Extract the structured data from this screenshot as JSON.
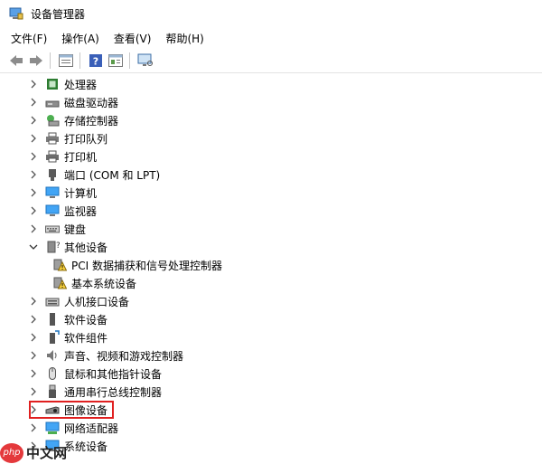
{
  "window": {
    "title": "设备管理器"
  },
  "menu": [
    {
      "label": "文件(F)",
      "name": "menu-file"
    },
    {
      "label": "操作(A)",
      "name": "menu-action"
    },
    {
      "label": "查看(V)",
      "name": "menu-view"
    },
    {
      "label": "帮助(H)",
      "name": "menu-help"
    }
  ],
  "toolbar": {
    "buttons": [
      "back-icon",
      "forward-icon",
      "properties-view-icon",
      "help-icon",
      "details-view-icon",
      "monitor-scan-icon"
    ]
  },
  "tree": {
    "items": [
      {
        "label": "处理器",
        "icon": "processor-icon",
        "expanded": false
      },
      {
        "label": "磁盘驱动器",
        "icon": "disk-drive-icon",
        "expanded": false
      },
      {
        "label": "存储控制器",
        "icon": "storage-controller-icon",
        "expanded": false
      },
      {
        "label": "打印队列",
        "icon": "print-queue-icon",
        "expanded": false
      },
      {
        "label": "打印机",
        "icon": "printer-icon",
        "expanded": false
      },
      {
        "label": "端口 (COM 和 LPT)",
        "icon": "port-icon",
        "expanded": false
      },
      {
        "label": "计算机",
        "icon": "computer-icon",
        "expanded": false
      },
      {
        "label": "监视器",
        "icon": "monitor-icon",
        "expanded": false
      },
      {
        "label": "键盘",
        "icon": "keyboard-icon",
        "expanded": false
      },
      {
        "label": "其他设备",
        "icon": "other-devices-icon",
        "expanded": true,
        "children": [
          {
            "label": "PCI 数据捕获和信号处理控制器",
            "icon": "warning-device-icon"
          },
          {
            "label": "基本系统设备",
            "icon": "warning-device-icon"
          }
        ]
      },
      {
        "label": "人机接口设备",
        "icon": "hid-icon",
        "expanded": false
      },
      {
        "label": "软件设备",
        "icon": "software-device-icon",
        "expanded": false
      },
      {
        "label": "软件组件",
        "icon": "software-component-icon",
        "expanded": false
      },
      {
        "label": "声音、视频和游戏控制器",
        "icon": "sound-icon",
        "expanded": false
      },
      {
        "label": "鼠标和其他指针设备",
        "icon": "mouse-icon",
        "expanded": false
      },
      {
        "label": "通用串行总线控制器",
        "icon": "usb-icon",
        "expanded": false
      },
      {
        "label": "图像设备",
        "icon": "camera-icon",
        "expanded": false,
        "highlighted": true
      },
      {
        "label": "网络适配器",
        "icon": "network-adapter-icon",
        "expanded": false
      },
      {
        "label": "系统设备",
        "icon": "system-device-icon",
        "expanded": false
      }
    ]
  },
  "watermark": {
    "logo_text": "php",
    "text": "中文网"
  },
  "colors": {
    "highlight": "#e02020",
    "accent": "#1e73be"
  }
}
